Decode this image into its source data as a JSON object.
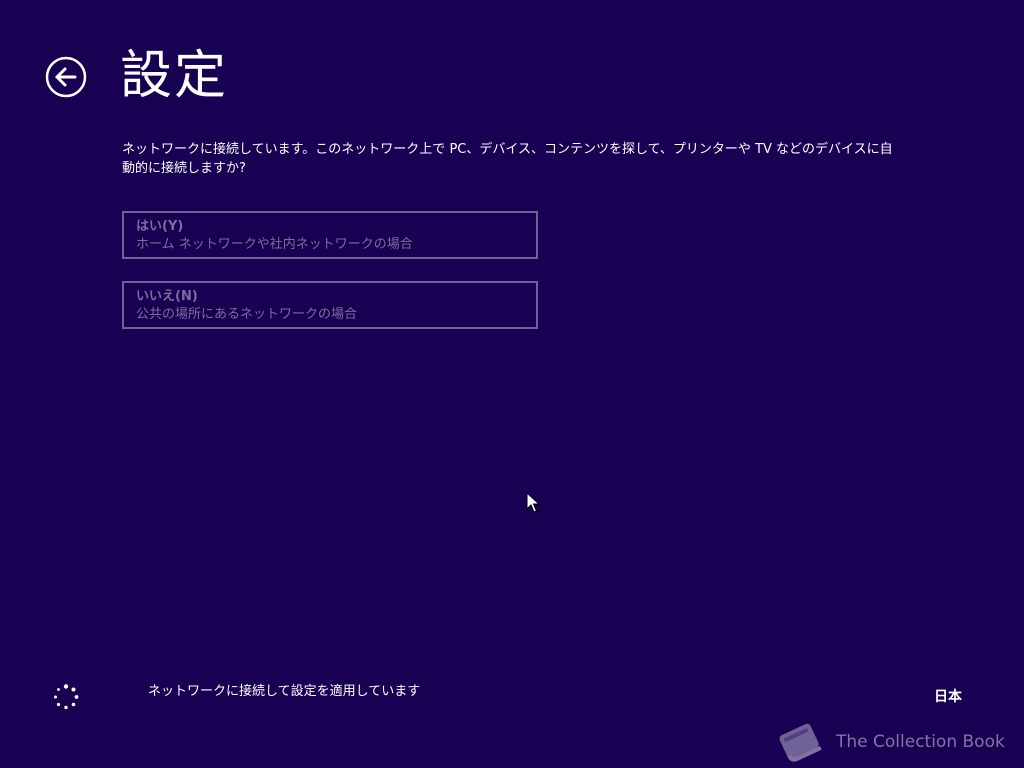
{
  "header": {
    "title": "設定"
  },
  "prompt": {
    "text": "ネットワークに接続しています。このネットワーク上で PC、デバイス、コンテンツを探して、プリンターや TV などのデバイスに自動的に接続しますか?"
  },
  "options": [
    {
      "title": "はい(Y)",
      "description": "ホーム ネットワークや社内ネットワークの場合"
    },
    {
      "title": "いいえ(N)",
      "description": "公共の場所にあるネットワークの場合"
    }
  ],
  "footer": {
    "status": "ネットワークに接続して設定を適用しています",
    "language": "日本"
  },
  "watermark": {
    "text": "The Collection Book"
  },
  "colors": {
    "background": "#180052",
    "text": "#ffffff",
    "disabled_text": "#7b6e9e"
  }
}
